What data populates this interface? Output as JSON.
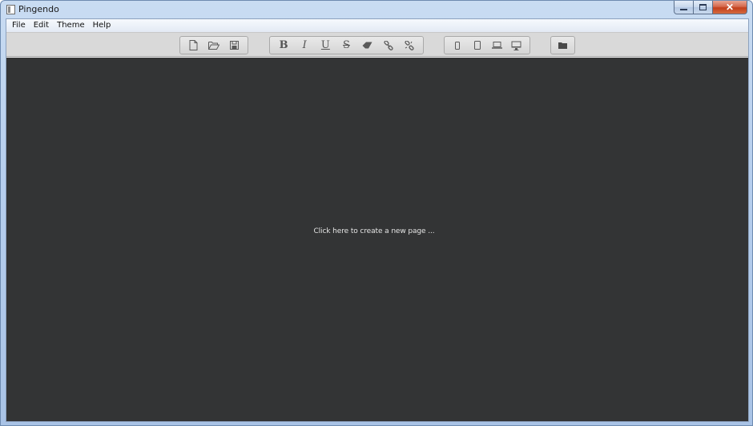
{
  "window": {
    "title": "Pingendo",
    "controls": {
      "minimize": "—",
      "maximize": "□",
      "close": "✕"
    }
  },
  "menubar": {
    "items": [
      "File",
      "Edit",
      "Theme",
      "Help"
    ]
  },
  "toolbar": {
    "file_group": [
      "new-file-icon",
      "open-folder-icon",
      "save-icon"
    ],
    "format_group": {
      "bold": "B",
      "italic": "I",
      "underline": "U",
      "strikethrough": "S",
      "icons": [
        "eraser-icon",
        "link-icon",
        "unlink-icon"
      ]
    },
    "device_group": [
      "phone-icon",
      "tablet-icon",
      "laptop-icon",
      "desktop-icon"
    ],
    "folder_group": [
      "folder-icon"
    ]
  },
  "canvas": {
    "empty_message": "Click here to create a new page ...",
    "background": "#333435"
  }
}
